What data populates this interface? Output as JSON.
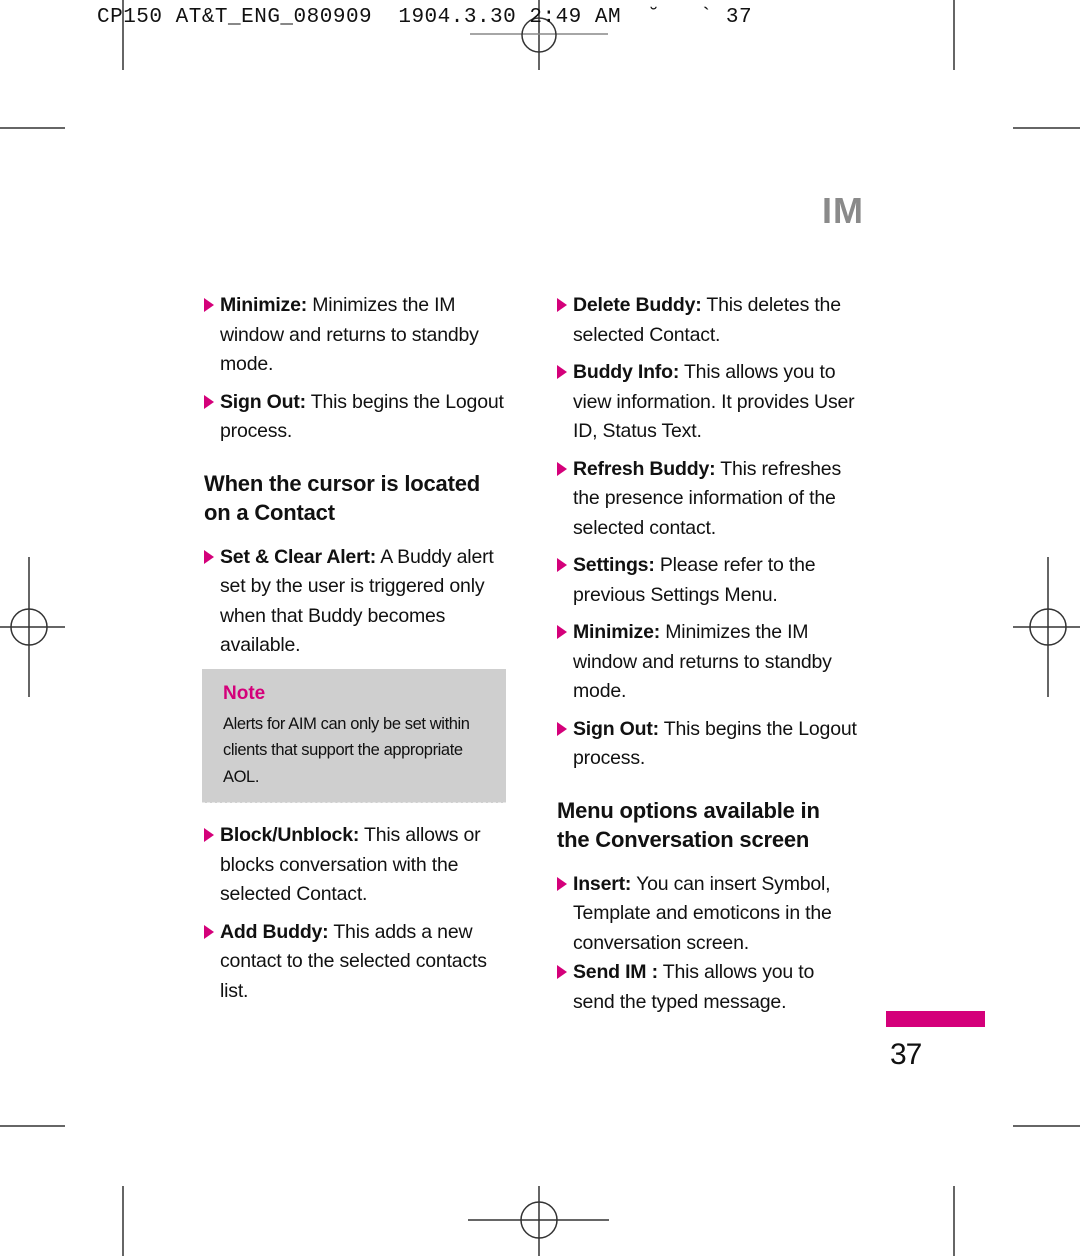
{
  "print_slug": "CP150 AT&T_ENG_080909  1904.3.30 2:49 AM  ˘   ` 37",
  "section_title": "IM",
  "colors": {
    "accent": "#d4007a",
    "note_bg": "#cfcfcf",
    "section_title": "#8a8a8a"
  },
  "left_column": {
    "items_top": [
      {
        "term": "Minimize:",
        "text": " Minimizes the IM window and returns to standby mode."
      },
      {
        "term": "Sign Out:",
        "text": " This begins the Logout process."
      }
    ],
    "heading": "When the cursor is located on a Contact",
    "items_contact": [
      {
        "term": "Set & Clear Alert:",
        "text": " A Buddy alert set by the user is triggered only when that Buddy becomes available."
      }
    ],
    "note": {
      "title": "Note",
      "body": "Alerts for AIM can only be set within clients that support the appropriate AOL."
    },
    "items_bottom": [
      {
        "term": "Block/Unblock:",
        "text": " This allows or blocks conversation with the selected Contact."
      },
      {
        "term": "Add Buddy:",
        "text": " This adds a new contact to the selected contacts list."
      }
    ]
  },
  "right_column": {
    "items_top": [
      {
        "term": "Delete Buddy:",
        "text": " This deletes the selected Contact."
      },
      {
        "term": "Buddy Info:",
        "text": " This allows you to view information. It provides User ID, Status Text."
      },
      {
        "term": "Refresh Buddy:",
        "text": " This refreshes the presence information of the selected contact."
      },
      {
        "term": "Settings:",
        "text": " Please refer to the previous Settings Menu."
      },
      {
        "term": "Minimize:",
        "text": " Minimizes the IM window and returns to standby mode."
      },
      {
        "term": "Sign Out:",
        "text": " This begins the Logout process."
      }
    ],
    "heading": "Menu options available in the Conversation screen",
    "items_conversation": [
      {
        "term": "Insert:",
        "text": " You can insert Symbol, Template and emoticons in the conversation screen."
      },
      {
        "term": "Send IM :",
        "text": " This allows you to send the typed message."
      }
    ]
  },
  "page_number": "37"
}
